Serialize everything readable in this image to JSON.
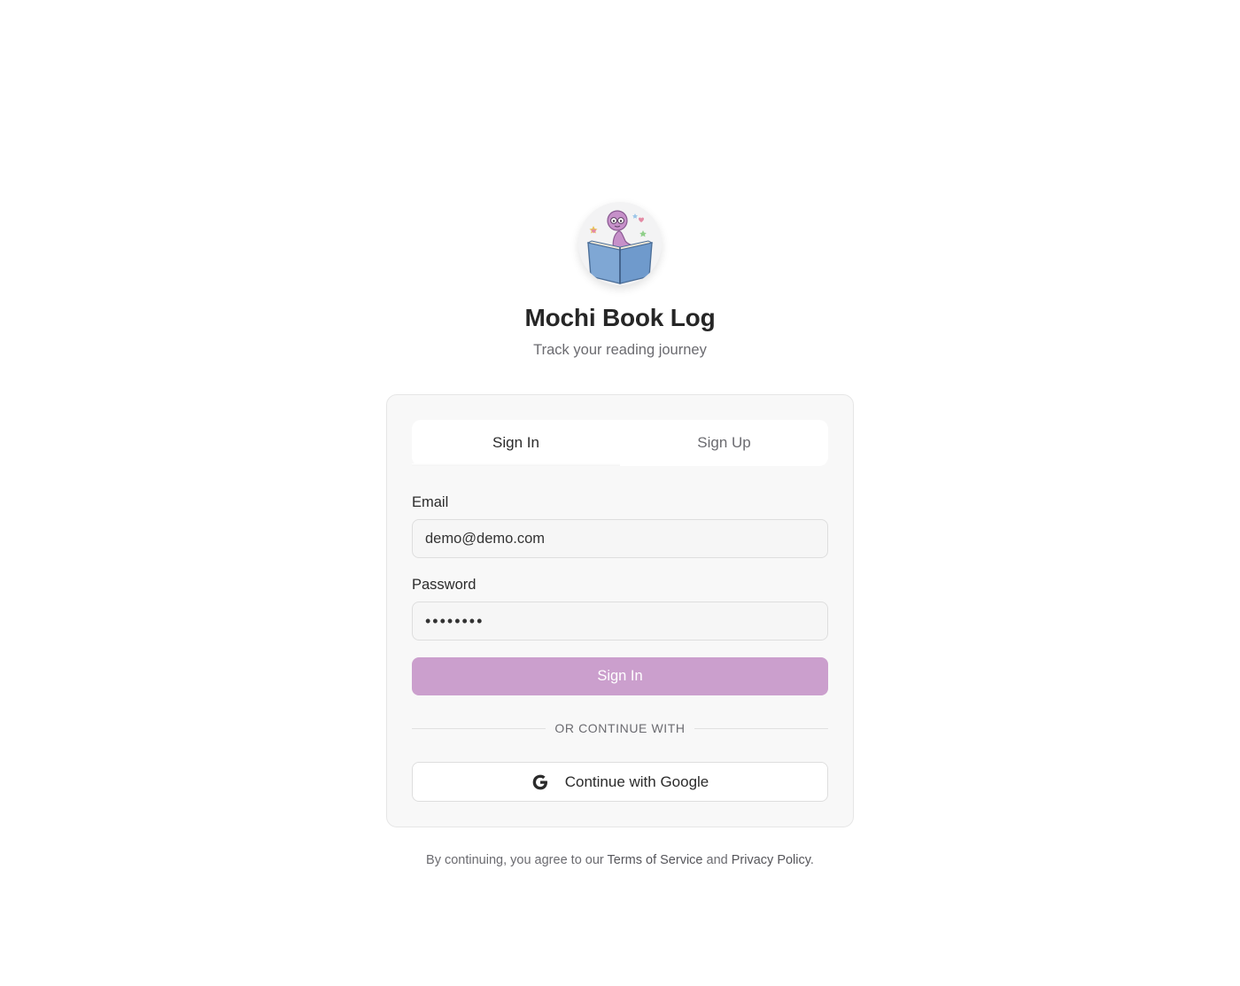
{
  "app": {
    "title": "Mochi Book Log",
    "subtitle": "Track your reading journey",
    "logo_icon": "bookworm-reading-book-icon"
  },
  "auth_tabs": [
    {
      "label": "Sign In",
      "active": true
    },
    {
      "label": "Sign Up",
      "active": false
    }
  ],
  "form": {
    "email_label": "Email",
    "email_value": "demo@demo.com",
    "password_label": "Password",
    "password_value": "••••••••",
    "submit_label": "Sign In"
  },
  "divider_text": "OR CONTINUE WITH",
  "google_button": {
    "label": "Continue with Google",
    "icon": "google-g-icon"
  },
  "footer": {
    "prefix": "By continuing, you agree to our ",
    "terms_link": "Terms of Service",
    "conjunction": " and ",
    "privacy_link": "Privacy Policy",
    "suffix": "."
  },
  "colors": {
    "accent": "#cb9fcd",
    "card_background": "#f8f8f8",
    "page_background": "#ffffff"
  }
}
